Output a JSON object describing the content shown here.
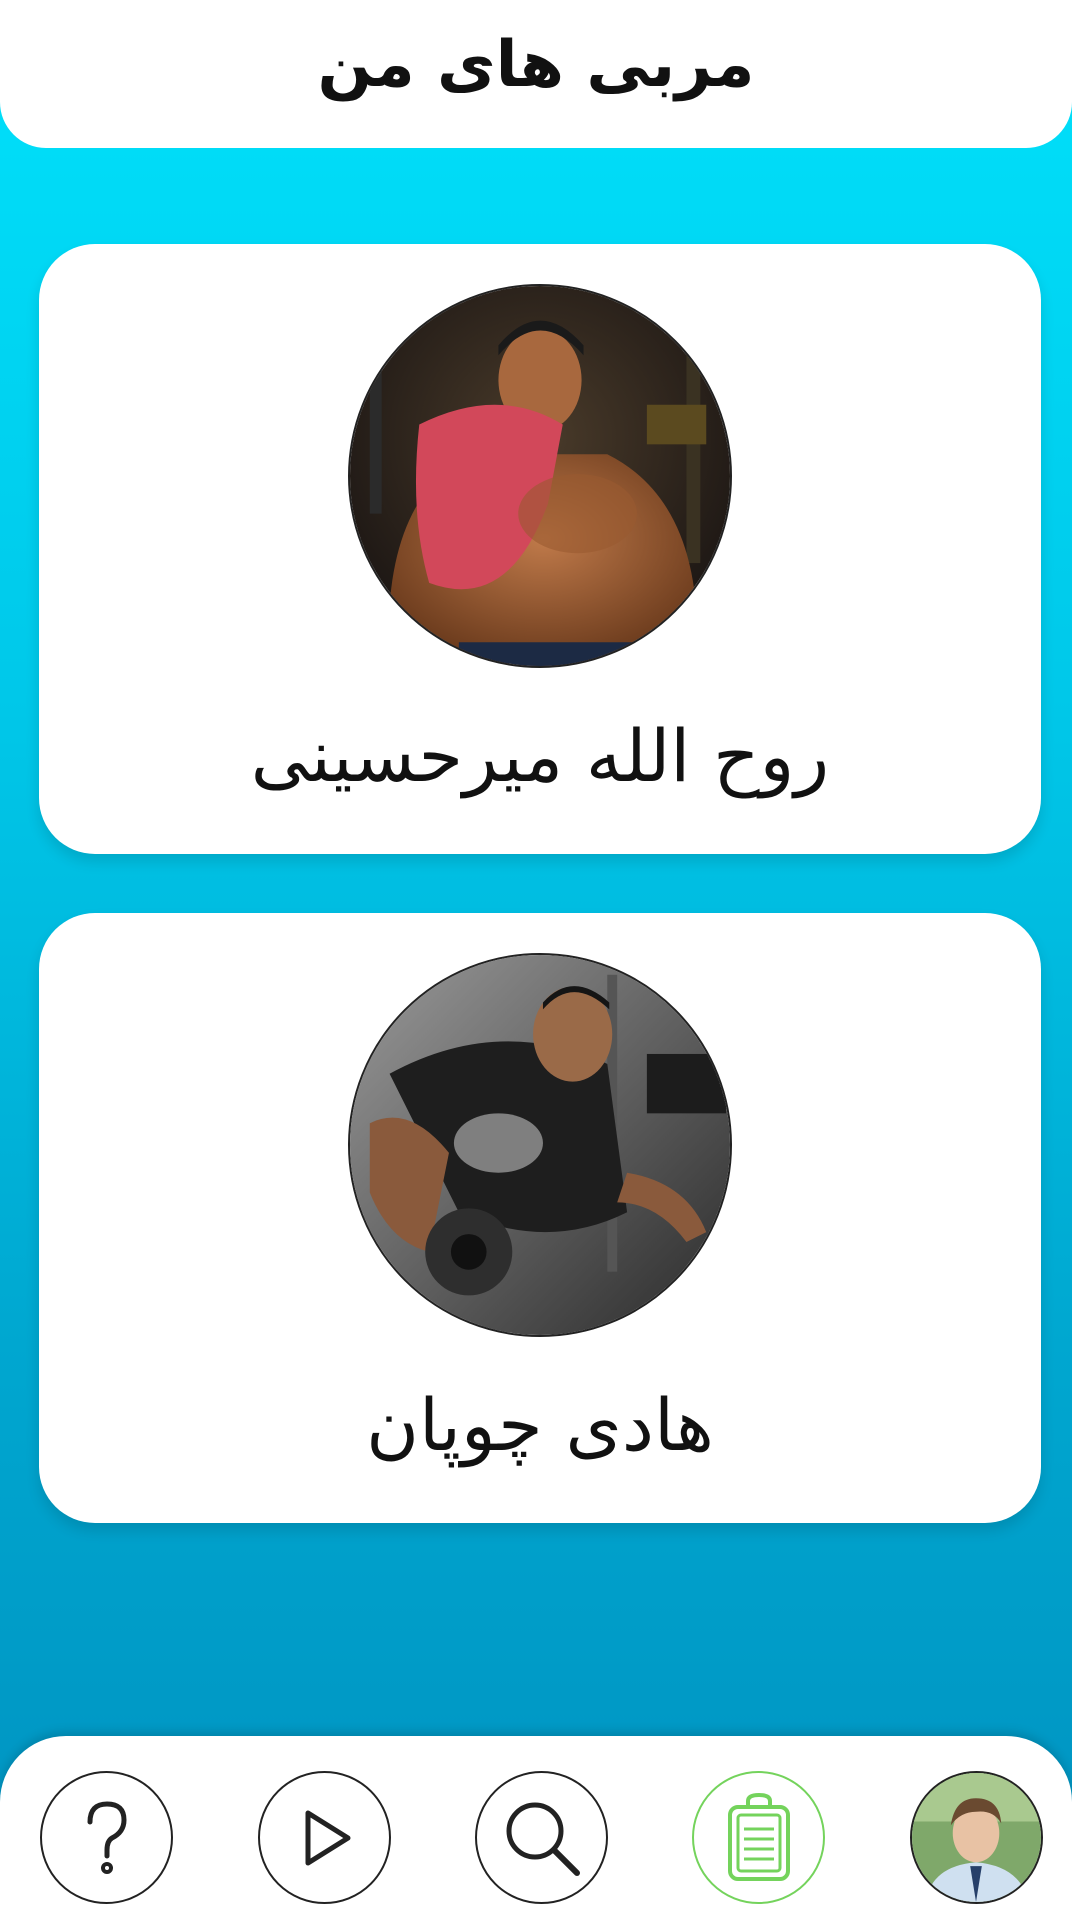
{
  "header": {
    "title": "مربی های من"
  },
  "coaches": [
    {
      "name": "روح الله میرحسینی",
      "photo": "bodybuilder-with-red-towel-photo"
    },
    {
      "name": "هادی چوپان",
      "photo": "bodybuilder-dumbbell-row-photo"
    }
  ],
  "bottom_nav": {
    "items": [
      {
        "icon": "help-icon"
      },
      {
        "icon": "play-icon"
      },
      {
        "icon": "search-icon"
      },
      {
        "icon": "clipboard-icon",
        "active": true
      },
      {
        "icon": "profile-avatar"
      }
    ]
  },
  "colors": {
    "background_top": "#00e1fb",
    "background_bottom": "#0092c0",
    "active_nav": "#74d35c"
  }
}
